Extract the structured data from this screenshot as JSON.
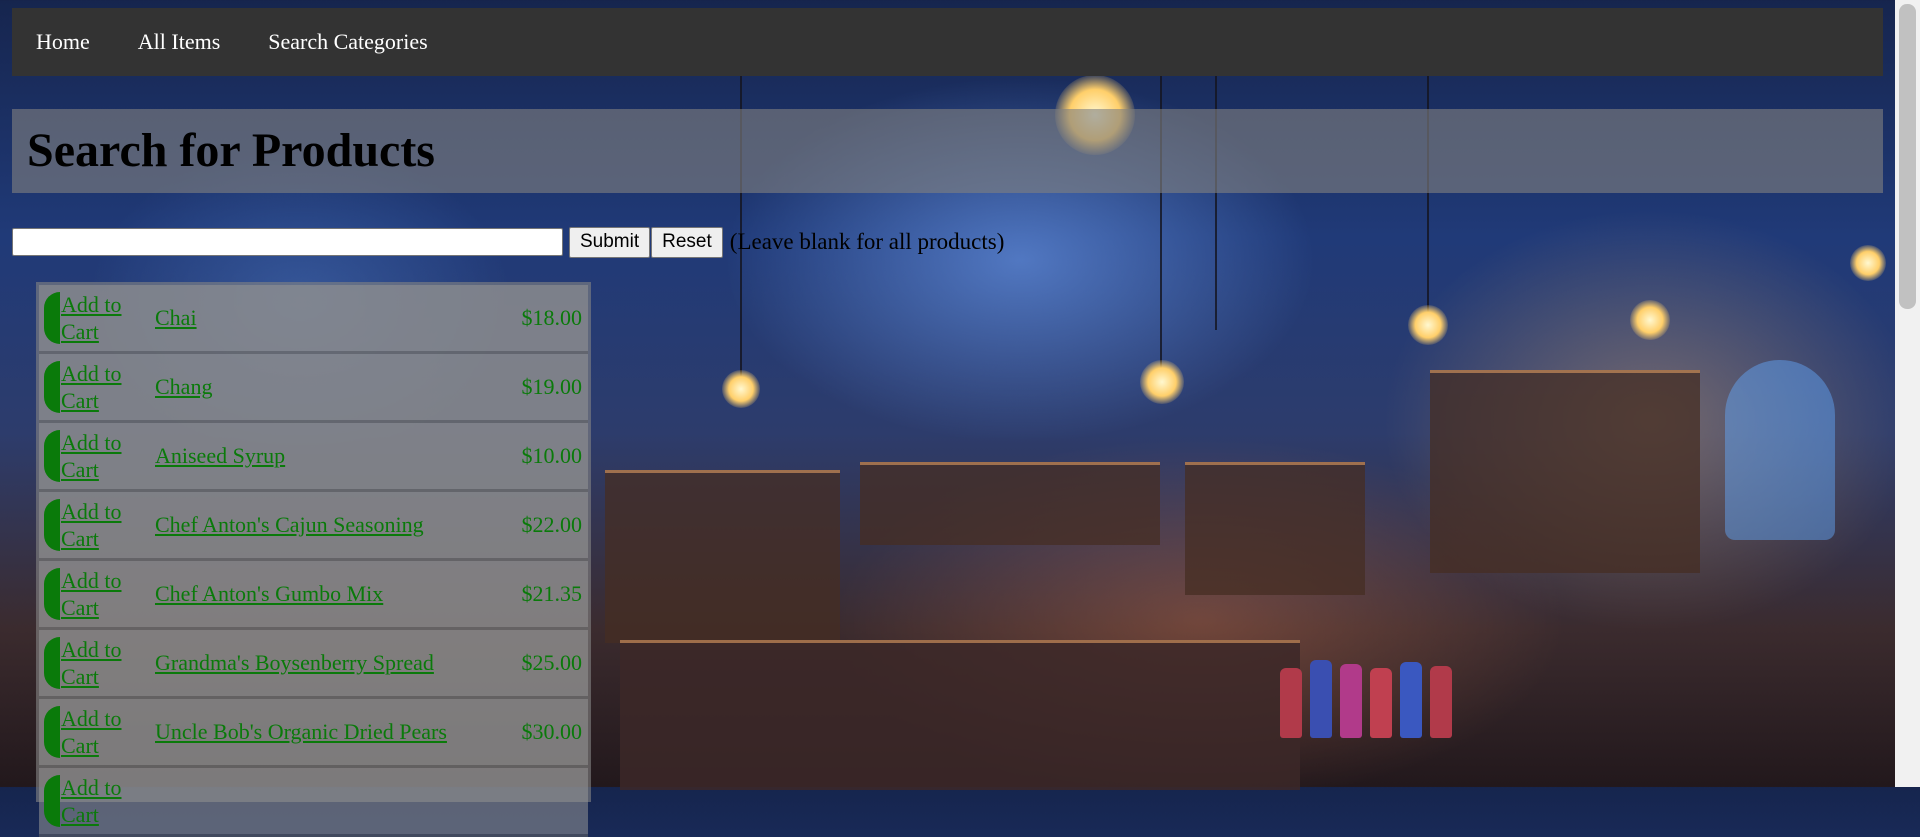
{
  "nav": {
    "items": [
      {
        "label": "Home"
      },
      {
        "label": "All Items"
      },
      {
        "label": "Search Categories"
      }
    ]
  },
  "page": {
    "title": "Search for Products"
  },
  "search": {
    "value": "",
    "placeholder": "",
    "submit_label": "Submit",
    "reset_label": "Reset",
    "hint": "(Leave blank for all products)"
  },
  "products": [
    {
      "add_label": "Add to Cart",
      "name": "Chai",
      "price": "$18.00"
    },
    {
      "add_label": "Add to Cart",
      "name": "Chang",
      "price": "$19.00"
    },
    {
      "add_label": "Add to Cart",
      "name": "Aniseed Syrup",
      "price": "$10.00"
    },
    {
      "add_label": "Add to Cart",
      "name": "Chef Anton's Cajun Seasoning",
      "price": "$22.00"
    },
    {
      "add_label": "Add to Cart",
      "name": "Chef Anton's Gumbo Mix",
      "price": "$21.35"
    },
    {
      "add_label": "Add to Cart",
      "name": "Grandma's Boysenberry Spread",
      "price": "$25.00"
    },
    {
      "add_label": "Add to Cart",
      "name": "Uncle Bob's Organic Dried Pears",
      "price": "$30.00"
    },
    {
      "add_label": "Add to Cart",
      "name": "",
      "price": ""
    }
  ],
  "colors": {
    "navbar": "#333333",
    "link_green": "#0a7a0a",
    "panel_gray": "#808080"
  }
}
